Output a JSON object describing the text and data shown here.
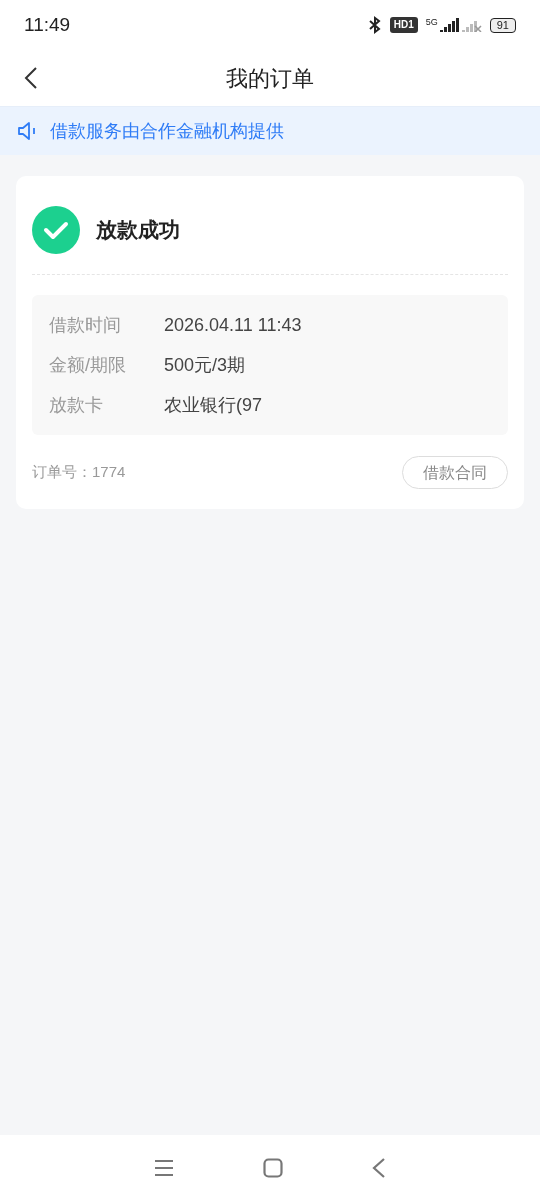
{
  "status_bar": {
    "time": "11:49",
    "hd_label": "HD1",
    "network": "5G",
    "battery": "91"
  },
  "header": {
    "title": "我的订单"
  },
  "notice": {
    "text": "借款服务由合作金融机构提供"
  },
  "order": {
    "status": "放款成功",
    "details": [
      {
        "label": "借款时间",
        "value": "2026.04.11 11:43"
      },
      {
        "label": "金额/期限",
        "value": "500元/3期"
      },
      {
        "label": "放款卡",
        "value": "农业银行(97"
      }
    ],
    "order_number": "订单号：1774",
    "contract_button": "借款合同"
  }
}
